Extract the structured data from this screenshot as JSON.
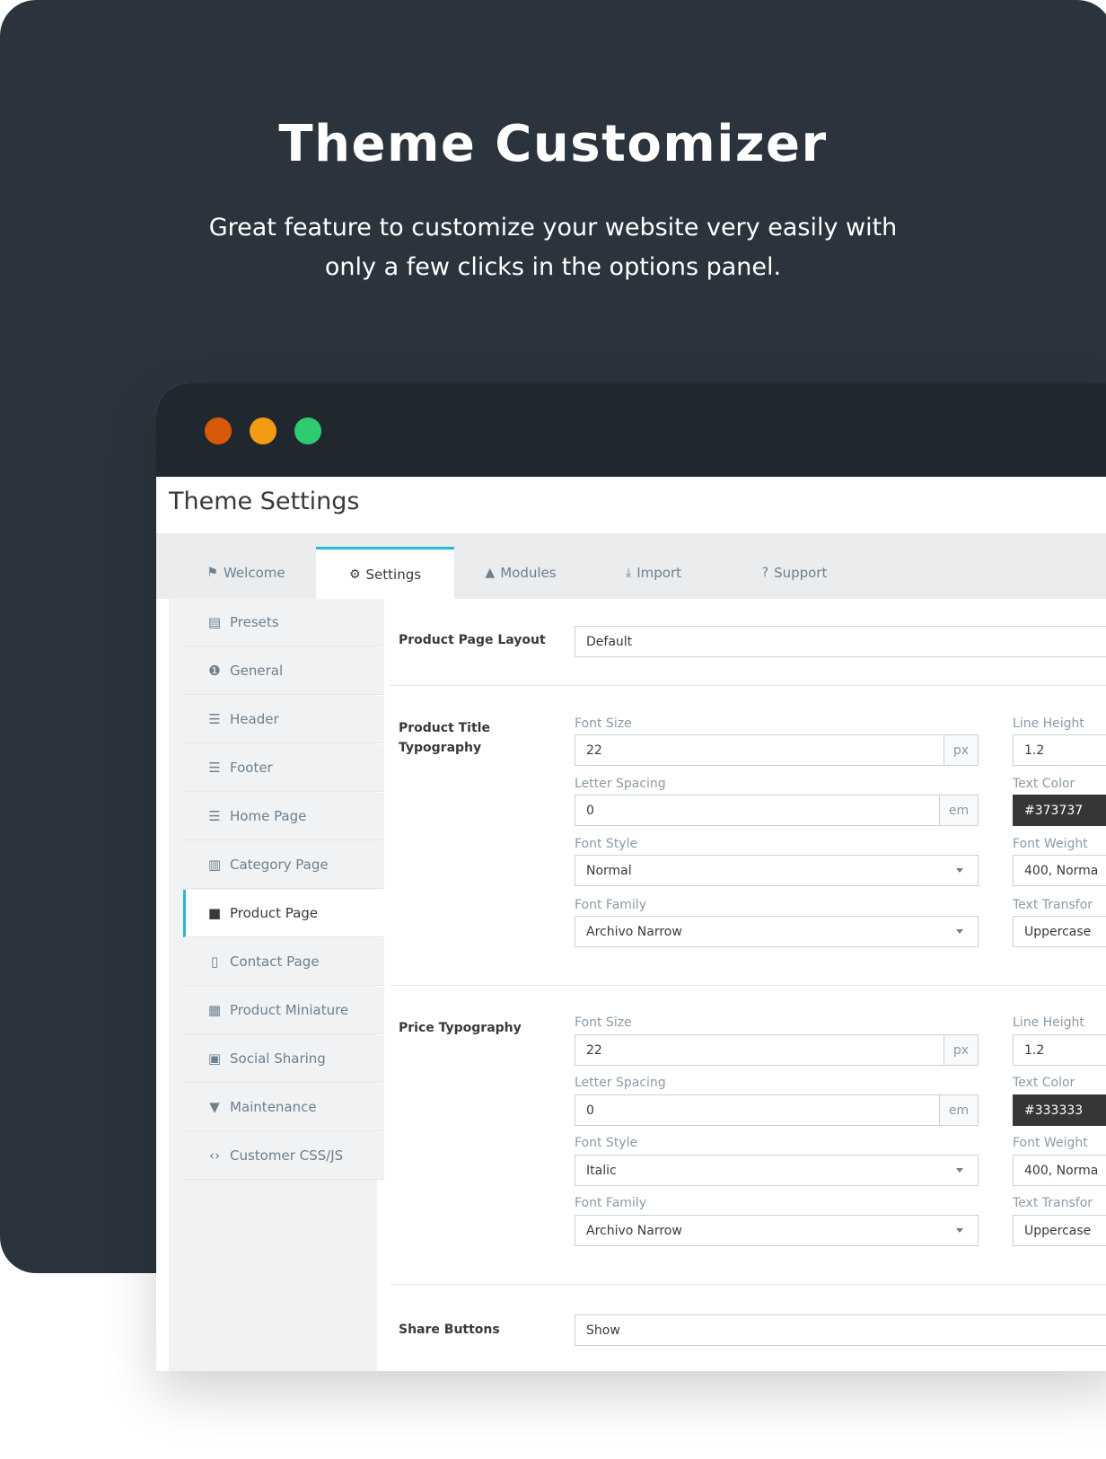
{
  "hero": {
    "title": "Theme Customizer",
    "subtitle_line1": "Great feature to customize your website very easily with",
    "subtitle_line2": "only a few clicks in the options panel."
  },
  "window": {
    "dots": [
      "red",
      "yellow",
      "green"
    ],
    "page_title": "Theme Settings"
  },
  "tabs": [
    {
      "label": "Welcome",
      "icon": "flag-icon"
    },
    {
      "label": "Settings",
      "icon": "gear-icon"
    },
    {
      "label": "Modules",
      "icon": "shapes-icon"
    },
    {
      "label": "Import",
      "icon": "download-icon"
    },
    {
      "label": "Support",
      "icon": "question-circle-icon"
    }
  ],
  "active_tab": "Settings",
  "sidebar": {
    "items": [
      {
        "label": "Presets",
        "icon": "document-icon"
      },
      {
        "label": "General",
        "icon": "number-one-icon"
      },
      {
        "label": "Header",
        "icon": "header-layout-icon"
      },
      {
        "label": "Footer",
        "icon": "footer-layout-icon"
      },
      {
        "label": "Home Page",
        "icon": "home-layout-icon"
      },
      {
        "label": "Category Page",
        "icon": "columns-icon"
      },
      {
        "label": "Product Page",
        "icon": "file-icon"
      },
      {
        "label": "Contact Page",
        "icon": "book-icon"
      },
      {
        "label": "Product Miniature",
        "icon": "grid-icon"
      },
      {
        "label": "Social Sharing",
        "icon": "folder-user-icon"
      },
      {
        "label": "Maintenance",
        "icon": "wifi-info-icon"
      },
      {
        "label": "Customer CSS/JS",
        "icon": "code-icon"
      }
    ],
    "active": "Product Page"
  },
  "form": {
    "layout": {
      "label": "Product Page Layout",
      "value": "Default"
    },
    "title_typography": {
      "label_line1": "Product Title",
      "label_line2": "Typography",
      "font_size_label": "Font Size",
      "font_size": "22",
      "font_size_unit": "px",
      "line_height_label": "Line Height",
      "line_height": "1.2",
      "letter_spacing_label": "Letter Spacing",
      "letter_spacing": "0",
      "letter_spacing_unit": "em",
      "text_color_label": "Text Color",
      "text_color": "#373737",
      "font_style_label": "Font Style",
      "font_style": "Normal",
      "font_weight_label": "Font Weight",
      "font_weight": "400, Norma",
      "font_family_label": "Font Family",
      "font_family": "Archivo Narrow",
      "text_transform_label": "Text Transfor",
      "text_transform": "Uppercase"
    },
    "price_typography": {
      "label": "Price Typography",
      "font_size_label": "Font Size",
      "font_size": "22",
      "font_size_unit": "px",
      "line_height_label": "Line Height",
      "line_height": "1.2",
      "letter_spacing_label": "Letter Spacing",
      "letter_spacing": "0",
      "letter_spacing_unit": "em",
      "text_color_label": "Text Color",
      "text_color": "#333333",
      "font_style_label": "Font Style",
      "font_style": "Italic",
      "font_weight_label": "Font Weight",
      "font_weight": "400, Norma",
      "font_family_label": "Font Family",
      "font_family": "Archivo Narrow",
      "text_transform_label": "Text Transfor",
      "text_transform": "Uppercase"
    },
    "share_buttons": {
      "label": "Share Buttons",
      "value": "Show"
    }
  },
  "colors": {
    "hero_bg": "#2b343c",
    "titlebar_bg": "#21272e",
    "accent": "#25b9d7",
    "dot_red": "#d9590b",
    "dot_yellow": "#f39c12",
    "dot_green": "#2ecc71"
  }
}
